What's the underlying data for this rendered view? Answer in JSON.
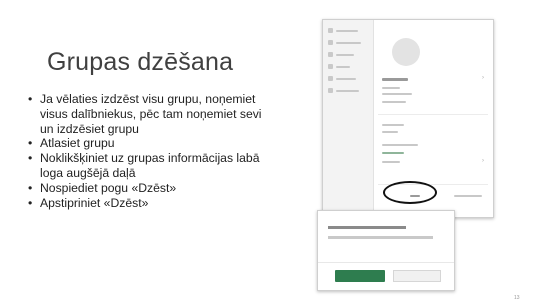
{
  "slide": {
    "title": "Grupas dzēšana",
    "page_number": "13",
    "bullets": [
      "Ja vēlaties izdzēst visu grupu, noņemiet visus dalībniekus, pēc tam noņemiet sevi un izdzēsiet grupu",
      "Atlasiet grupu",
      "Noklikšķiniet uz grupas informācijas labā loga augšējā daļā",
      "Nospiediet pogu «Dzēst»",
      "Apstipriniet «Dzēst»"
    ],
    "bullet_glyph": "•"
  },
  "colors": {
    "title": "#404040",
    "confirm_button": "#2e7d4f",
    "highlight_ellipse": "#111111"
  }
}
